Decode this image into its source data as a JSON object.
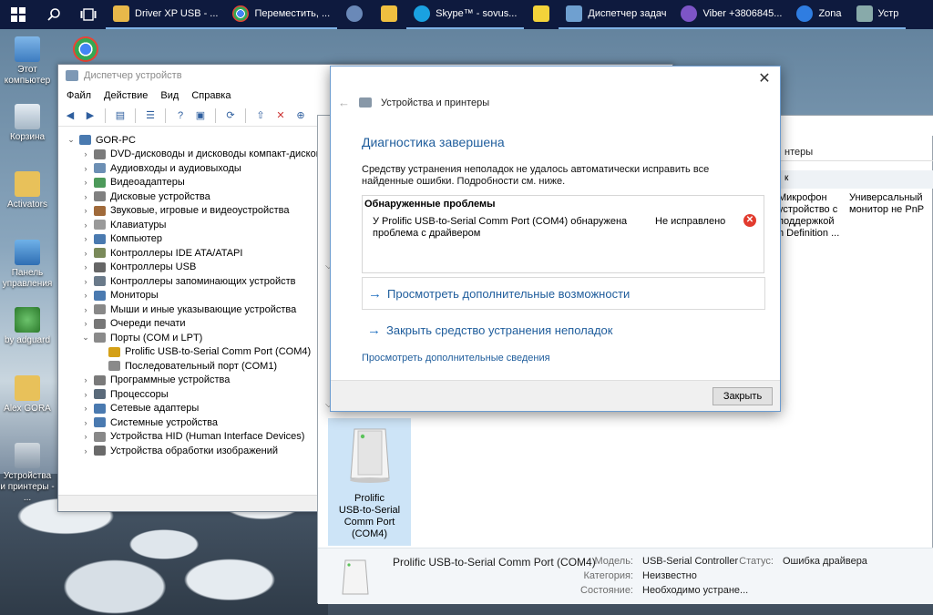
{
  "taskbar": {
    "items": [
      {
        "label": "Driver XP USB - ...",
        "color": "#e8b84a"
      },
      {
        "label": "Переместить, ...",
        "color": "#4caf50"
      },
      {
        "label": "",
        "color": "#6a89b8"
      },
      {
        "label": "",
        "color": "#f0c040"
      },
      {
        "label": "Skype™ - sovus...",
        "color": "#1aa1e1"
      },
      {
        "label": "",
        "color": "#333333"
      },
      {
        "label": "Диспетчер задач",
        "color": "#6fa0d0"
      },
      {
        "label": "Viber +3806845...",
        "color": "#7d55c7"
      },
      {
        "label": "Zona",
        "color": "#2f7de1"
      },
      {
        "label": "Устр",
        "color": "#8aa"
      }
    ]
  },
  "desktop": {
    "icons": [
      {
        "label": "Этот компьютер"
      },
      {
        "label": ""
      },
      {
        "label": "Корзина"
      },
      {
        "label": "Activators"
      },
      {
        "label": "Панель управления"
      },
      {
        "label": "by adguard"
      },
      {
        "label": "Alex GORA"
      },
      {
        "label": "Устройства и принтеры - ..."
      }
    ]
  },
  "devmgr": {
    "title": "Диспетчер устройств",
    "menu": [
      "Файл",
      "Действие",
      "Вид",
      "Справка"
    ],
    "tree": [
      {
        "label": "GOR-PC",
        "level": 0,
        "arrow": "v",
        "color": "#4a7ab0"
      },
      {
        "label": "DVD-дисководы и дисководы компакт-дисков",
        "level": 1,
        "arrow": ">",
        "color": "#7b7b7b"
      },
      {
        "label": "Аудиовходы и аудиовыходы",
        "level": 1,
        "arrow": ">",
        "color": "#6c8fb4"
      },
      {
        "label": "Видеоадаптеры",
        "level": 1,
        "arrow": ">",
        "color": "#4d9a5a"
      },
      {
        "label": "Дисковые устройства",
        "level": 1,
        "arrow": ">",
        "color": "#808080"
      },
      {
        "label": "Звуковые, игровые и видеоустройства",
        "level": 1,
        "arrow": ">",
        "color": "#a06a3a"
      },
      {
        "label": "Клавиатуры",
        "level": 1,
        "arrow": ">",
        "color": "#9a9a9a"
      },
      {
        "label": "Компьютер",
        "level": 1,
        "arrow": ">",
        "color": "#4a7ab0"
      },
      {
        "label": "Контроллеры IDE ATA/ATAPI",
        "level": 1,
        "arrow": ">",
        "color": "#7a8a5a"
      },
      {
        "label": "Контроллеры USB",
        "level": 1,
        "arrow": ">",
        "color": "#666666"
      },
      {
        "label": "Контроллеры запоминающих устройств",
        "level": 1,
        "arrow": ">",
        "color": "#6a7a8a"
      },
      {
        "label": "Мониторы",
        "level": 1,
        "arrow": ">",
        "color": "#4a7ab0"
      },
      {
        "label": "Мыши и иные указывающие устройства",
        "level": 1,
        "arrow": ">",
        "color": "#888888"
      },
      {
        "label": "Очереди печати",
        "level": 1,
        "arrow": ">",
        "color": "#777777"
      },
      {
        "label": "Порты (COM и LPT)",
        "level": 1,
        "arrow": "v",
        "color": "#8a8a8a"
      },
      {
        "label": "Prolific USB-to-Serial Comm Port (COM4)",
        "level": 2,
        "arrow": "",
        "color": "#d4a017"
      },
      {
        "label": "Последовательный порт (COM1)",
        "level": 2,
        "arrow": "",
        "color": "#8a8a8a"
      },
      {
        "label": "Программные устройства",
        "level": 1,
        "arrow": ">",
        "color": "#7a7a7a"
      },
      {
        "label": "Процессоры",
        "level": 1,
        "arrow": ">",
        "color": "#5a6a7a"
      },
      {
        "label": "Сетевые адаптеры",
        "level": 1,
        "arrow": ">",
        "color": "#4a7ab0"
      },
      {
        "label": "Системные устройства",
        "level": 1,
        "arrow": ">",
        "color": "#4a7ab0"
      },
      {
        "label": "Устройства HID (Human Interface Devices)",
        "level": 1,
        "arrow": ">",
        "color": "#888888"
      },
      {
        "label": "Устройства обработки изображений",
        "level": 1,
        "arrow": ">",
        "color": "#6a6a6a"
      }
    ]
  },
  "devprn": {
    "address": "нтеры",
    "header": "к",
    "devices": [
      {
        "label": "Микрофон\nустройство с\nподдержкой\nh Definition ..."
      },
      {
        "label": "Универсальный\nмонитор не PnP"
      }
    ],
    "selected_tile": "Prolific\nUSB-to-Serial\nComm Port\n(COM4)",
    "details": {
      "name": "Prolific USB-to-Serial Comm Port (COM4)",
      "model_label": "Модель:",
      "model_value": "USB-Serial Controller",
      "status_label": "Статус:",
      "status_value": "Ошибка драйвера",
      "category_label": "Категория:",
      "category_value": "Неизвестно",
      "state_label": "Состояние:",
      "state_value": "Необходимо устране..."
    }
  },
  "dialog": {
    "breadcrumb": "Устройства и принтеры",
    "heading": "Диагностика завершена",
    "intro": "Средству устранения неполадок не удалось автоматически исправить все найденные ошибки. Подробности см. ниже.",
    "problems_header": "Обнаруженные проблемы",
    "problem_desc": "У Prolific USB-to-Serial Comm Port (COM4) обнаружена проблема с драйвером",
    "problem_status": "Не исправлено",
    "option1": "Просмотреть дополнительные возможности",
    "option2": "Закрыть средство устранения неполадок",
    "details_link": "Просмотреть дополнительные сведения",
    "close_button": "Закрыть"
  }
}
